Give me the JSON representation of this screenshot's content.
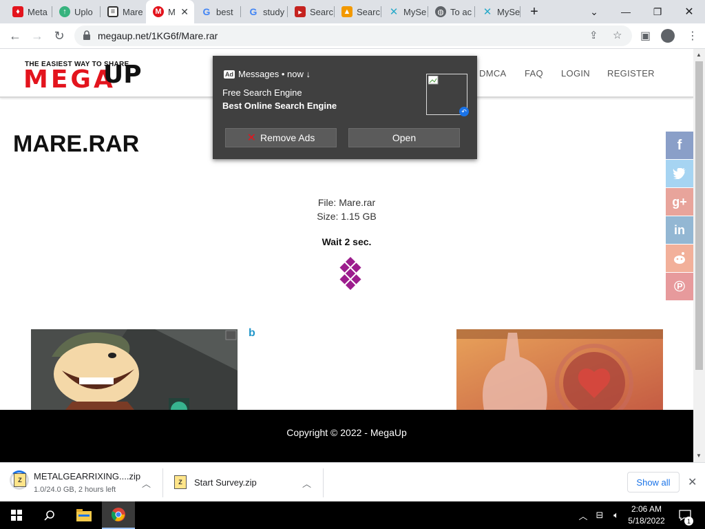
{
  "browser": {
    "tabs": [
      {
        "label": "Meta",
        "icon": "metal-icon"
      },
      {
        "label": "Uplo",
        "icon": "upload-icon"
      },
      {
        "label": "Mare",
        "icon": "file-icon"
      },
      {
        "label": "M",
        "icon": "megaup-icon",
        "active": true
      },
      {
        "label": "best",
        "icon": "google-icon"
      },
      {
        "label": "study",
        "icon": "google-icon"
      },
      {
        "label": "Searc",
        "icon": "search-ext-icon"
      },
      {
        "label": "Searc",
        "icon": "search-ext-icon"
      },
      {
        "label": "MySe",
        "icon": "myse-icon"
      },
      {
        "label": "To ac",
        "icon": "globe-icon"
      },
      {
        "label": "MySe",
        "icon": "myse-icon"
      }
    ],
    "new_tab_label": "+",
    "url": "megaup.net/1KG6f/Mare.rar"
  },
  "site": {
    "logo_tagline": "THE EASIEST WAY TO SHARE",
    "logo_text": "MEGA",
    "logo_up": "UP",
    "nav": [
      "DMCA",
      "FAQ",
      "LOGIN",
      "REGISTER"
    ],
    "title": "MARE.RAR",
    "file_line": "File: Mare.rar",
    "size_line": "Size: 1.15 GB",
    "wait_text": "Wait 2 sec.",
    "footer": "Copyright © 2022 - MegaUp",
    "ad_marker": "b"
  },
  "popup": {
    "badge": "Ad",
    "header": "Messages • now ↓",
    "line1": "Free Search Engine",
    "line2": "Best Online Search Engine",
    "remove_label": "Remove Ads",
    "open_label": "Open"
  },
  "social": [
    {
      "name": "facebook",
      "glyph": "f",
      "color": "#8a9fc8"
    },
    {
      "name": "twitter",
      "glyph": "t",
      "color": "#a6d4f2"
    },
    {
      "name": "google-plus",
      "glyph": "g+",
      "color": "#e8a49b"
    },
    {
      "name": "linkedin",
      "glyph": "in",
      "color": "#93b7d3"
    },
    {
      "name": "reddit",
      "glyph": "r",
      "color": "#f2b09a"
    },
    {
      "name": "pinterest",
      "glyph": "p",
      "color": "#e79a9c"
    }
  ],
  "downloads": [
    {
      "name": "METALGEARRIXING....zip",
      "status": "1.0/24.0 GB, 2 hours left"
    },
    {
      "name": "Start Survey.zip",
      "status": ""
    }
  ],
  "download_bar": {
    "show_all": "Show all"
  },
  "taskbar": {
    "time": "2:06 AM",
    "date": "5/18/2022",
    "notifications": "1"
  }
}
